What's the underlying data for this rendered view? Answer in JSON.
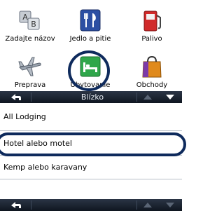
{
  "categories": [
    {
      "label": "Zadajte názov",
      "icon": "ab-blocks-icon"
    },
    {
      "label": "Jedlo a pitie",
      "icon": "fork-knife-icon"
    },
    {
      "label": "Palivo",
      "icon": "fuel-pump-icon"
    },
    {
      "label": "Preprava",
      "icon": "airplane-icon"
    },
    {
      "label": "Ubytovanie",
      "icon": "bed-icon"
    },
    {
      "label": "Obchody",
      "icon": "shopping-bag-icon"
    }
  ],
  "nav_top": {
    "title": "Blízko"
  },
  "lodging_list": [
    {
      "label": "All Lodging"
    },
    {
      "label": "Hotel alebo motel"
    },
    {
      "label": "Kemp alebo karavany"
    }
  ],
  "colors": {
    "highlight_ring": "#0e2a5c",
    "nav_bar": "#1b2432",
    "bed_icon_green": "#2fa64a"
  }
}
